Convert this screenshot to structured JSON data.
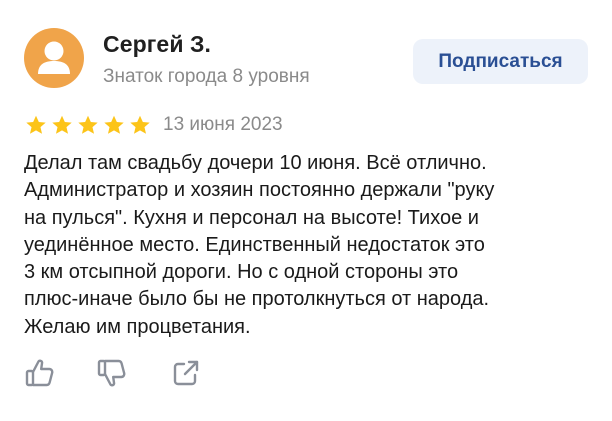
{
  "author": {
    "name": "Сергей З.",
    "level": "Знаток города 8 уровня",
    "avatar_color": "#f0a44a"
  },
  "subscribe_button": {
    "label": "Подписаться",
    "bg_color": "#edf2fa",
    "text_color": "#2a4f94"
  },
  "rating": {
    "stars": 5,
    "max_stars": 5,
    "star_color": "#fcc419"
  },
  "date": "13 июня 2023",
  "review": {
    "lines": [
      "Делал там свадьбу дочери 10 июня. Всё отлично.",
      "Администратор и хозяин постоянно держали \"руку",
      "на пулься\". Кухня и персонал на высоте! Тихое и",
      "уединённое место. Единственный недостаток это",
      "3 км отсыпной дороги. Но с одной стороны это",
      "плюс-иначе было бы не протолкнуться от народа.",
      "Желаю им процветания."
    ]
  },
  "actions": {
    "icons": [
      "thumbs-up-icon",
      "thumbs-down-icon",
      "share-icon"
    ]
  }
}
